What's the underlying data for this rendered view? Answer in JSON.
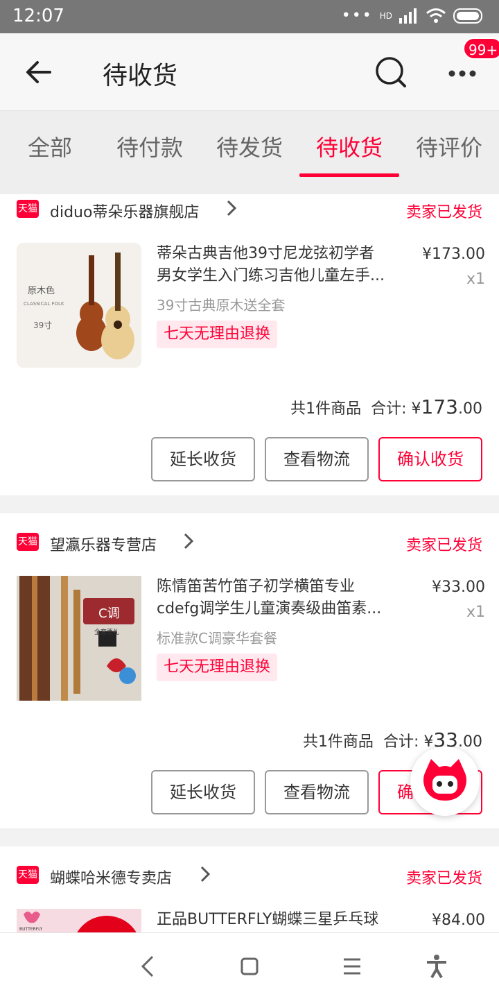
{
  "status_bar": {
    "time": "12:07",
    "network": "HD"
  },
  "header": {
    "title": "待收货",
    "badge": "99+"
  },
  "tabs": [
    {
      "label": "全部"
    },
    {
      "label": "待付款"
    },
    {
      "label": "待发货"
    },
    {
      "label": "待收货",
      "active": true
    },
    {
      "label": "待评价"
    }
  ],
  "orders": [
    {
      "shop_badge": "天猫",
      "shop": "diduo蒂朵乐器旗舰店",
      "status": "卖家已发货",
      "title_line1": "蒂朵古典吉他39寸尼龙弦初学者",
      "title_line2": "男女学生入门练习吉他儿童左手...",
      "price": "¥173.00",
      "qty": "x1",
      "sku": "39寸古典原木送全套",
      "tag": "七天无理由退换",
      "thumb_text1": "原木色",
      "thumb_text2": "CLASSICAL FOLK",
      "thumb_text3": "39寸",
      "count_text": "共1件商品",
      "total_label": "合计:",
      "total_currency": "¥",
      "total_int": "173",
      "total_dec": ".00",
      "btn_extend": "延长收货",
      "btn_logistics": "查看物流",
      "btn_confirm": "确认收货"
    },
    {
      "shop_badge": "天猫",
      "shop": "望瀛乐器专营店",
      "status": "卖家已发货",
      "title_line1": "陈情笛苦竹笛子初学横笛专业",
      "title_line2": "cdefg调学生儿童演奏级曲笛素...",
      "price": "¥33.00",
      "qty": "x1",
      "sku": "标准款C调豪华套餐",
      "tag": "七天无理由退换",
      "thumb_text1": "C调",
      "thumb_text2": "全套票礼",
      "count_text": "共1件商品",
      "total_label": "合计:",
      "total_currency": "¥",
      "total_int": "33",
      "total_dec": ".00",
      "btn_extend": "延长收货",
      "btn_logistics": "查看物流",
      "btn_confirm": "确认收货"
    },
    {
      "shop_badge": "天猫",
      "shop": "蝴蝶哈米德专卖店",
      "status": "卖家已发货",
      "title_line1": "正品BUTTERFLY蝴蝶三星乒乓球",
      "price": "¥84.00",
      "thumb_text1": "BUTTERFLY"
    }
  ],
  "colors": {
    "accent": "#ff0036",
    "statusbar": "#777777",
    "tag_bg": "#ffe9ee"
  }
}
